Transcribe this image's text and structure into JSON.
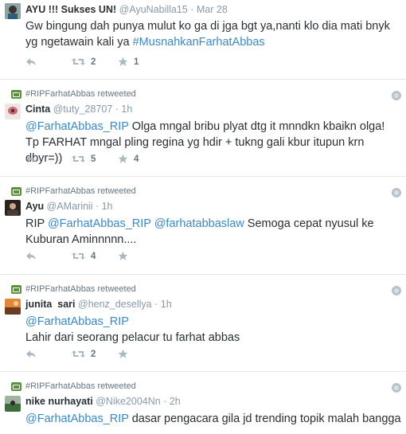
{
  "tweets": [
    {
      "retweeted_by": "",
      "name": "AYU !!! Sukses UN!",
      "handle": "@AyuNabilla15",
      "time": "Mar 28",
      "text_plain": "Gw bingung dah punya mulut ko ga di jga bgt ya,nanti klo dia mati bnyk yg ngetawain kali ya ",
      "hashtag": "#MusnahkanFarhatAbbas",
      "retweets": "2",
      "favorites": "1"
    },
    {
      "retweeted_by": "#RIPFarhatAbbas retweeted",
      "name": "Cinta",
      "handle": "@tuty_28707",
      "time": "1h",
      "mention1": "@FarhatAbbas_RIP",
      "text_plain": " Olga mngal bribu plyat dtg it mnndkn kbaikn olga! Tp FARHAT mngal pling regina yg hdir + tukng gali kbur itupun krn dbyr=))",
      "retweets": "5",
      "favorites": "4"
    },
    {
      "retweeted_by": "#RIPFarhatAbbas retweeted",
      "name": "Ayu",
      "handle": "@AMarinii",
      "time": "1h",
      "prefix": "RIP ",
      "mention1": "@FarhatAbbas_RIP",
      "mention2": "@farhatabbaslaw",
      "text_plain": " Semoga cepat nyusul ke Kuburan Aminnnnn....",
      "retweets": "4",
      "favorites": ""
    },
    {
      "retweeted_by": "#RIPFarhatAbbas retweeted",
      "name": "junita  sari",
      "handle": "@henz_desellya",
      "time": "1h",
      "mention1": "@FarhatAbbas_RIP",
      "text_plain": "Lahir dari seorang pelacur tu farhat abbas",
      "retweets": "2",
      "favorites": ""
    },
    {
      "retweeted_by": "#RIPFarhatAbbas retweeted",
      "name": "nike nurhayati",
      "handle": "@Nike2004Nn",
      "time": "2h",
      "mention1": "@FarhatAbbas_RIP",
      "text_plain": " dasar pengacara gila jd trending topik malah bangga"
    }
  ],
  "colors": {
    "link": "#3b88c3",
    "retweet_green": "#5c913b",
    "muted": "#8899a6"
  }
}
